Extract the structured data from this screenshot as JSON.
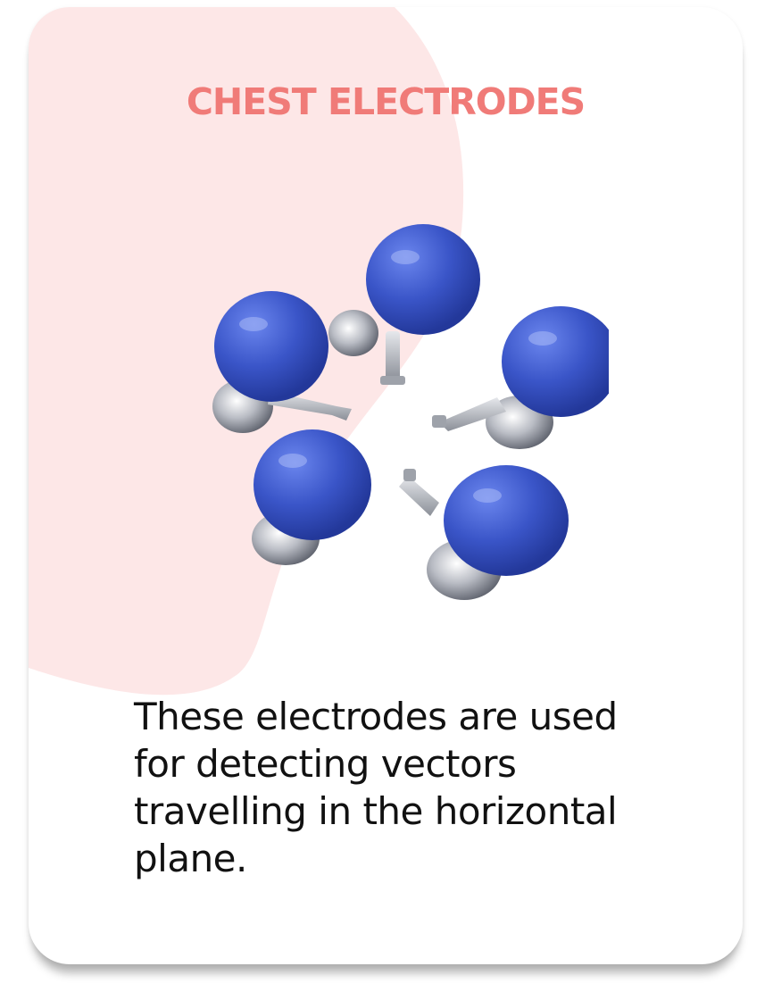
{
  "card": {
    "title": "CHEST ELECTRODES",
    "description": "These electrodes are used for detecting vectors travelling in the horizontal plane.",
    "image": {
      "name": "chest-electrodes-illustration",
      "bulb_count": 5,
      "bulb_color": "#3a55c8"
    }
  },
  "colors": {
    "title": "#f07b78",
    "blob": "#fde7e7",
    "text": "#111111"
  }
}
